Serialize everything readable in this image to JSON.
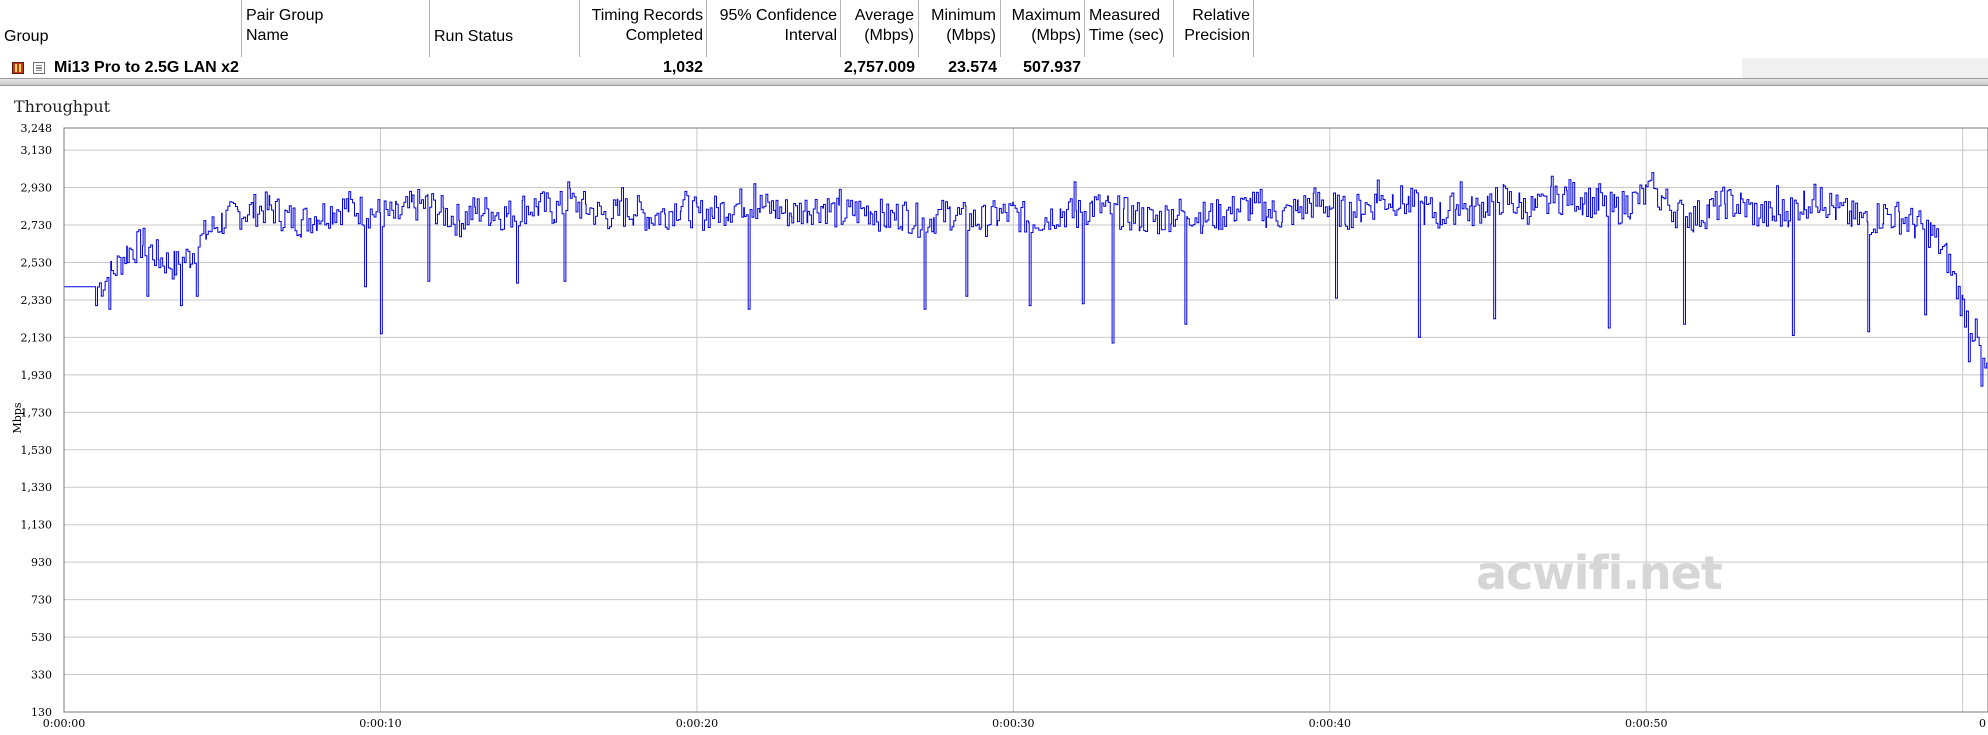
{
  "grid": {
    "columns": [
      {
        "key": "group",
        "label": "Group"
      },
      {
        "key": "pair_group_name",
        "label": "Pair Group Name"
      },
      {
        "key": "run_status",
        "label": "Run Status"
      },
      {
        "key": "timing_records",
        "label": "Timing Records Completed"
      },
      {
        "key": "confidence",
        "label": "95% Confidence Interval"
      },
      {
        "key": "average",
        "label": "Average (Mbps)"
      },
      {
        "key": "minimum",
        "label": "Minimum (Mbps)"
      },
      {
        "key": "maximum",
        "label": "Maximum (Mbps)"
      },
      {
        "key": "measured_time",
        "label": "Measured Time (sec)"
      },
      {
        "key": "relative_precision",
        "label": "Relative Precision"
      }
    ],
    "row": {
      "group": "Mi13 Pro to 2.5G LAN x2",
      "timing_records": "1,032",
      "average": "2,757.009",
      "minimum": "23.574",
      "maximum": "507.937"
    }
  },
  "watermark": "acwifi.net",
  "chart_data": {
    "type": "line",
    "title": "Throughput",
    "ylabel": "Mbps",
    "ylim": [
      130,
      3248
    ],
    "yticks": [
      "3,248",
      "3,130",
      "2,930",
      "2,730",
      "2,530",
      "2,330",
      "2,130",
      "1,930",
      "1,730",
      "1,530",
      "1,330",
      "1,130",
      "930",
      "730",
      "530",
      "330",
      "130"
    ],
    "ytick_values": [
      3248,
      3130,
      2930,
      2730,
      2530,
      2330,
      2130,
      1930,
      1730,
      1530,
      1330,
      1130,
      930,
      730,
      530,
      330,
      130
    ],
    "xlim": [
      0,
      60.8
    ],
    "xticks": [
      "0:00:00",
      "0:00:10",
      "0:00:20",
      "0:00:30",
      "0:00:40",
      "0:00:50",
      "0"
    ],
    "xtick_values": [
      0,
      10,
      20,
      30,
      40,
      50,
      60
    ],
    "grid": true,
    "series": [
      {
        "color": "#0000e0",
        "x": [
          0,
          1,
          1.5,
          2,
          2.5,
          3,
          3.5,
          4,
          4.5,
          5,
          5.5,
          6,
          6.5,
          7,
          7.5,
          8,
          8.5,
          9,
          9.5,
          10,
          10.5,
          11,
          11.5,
          12,
          12.5,
          13,
          13.5,
          14,
          14.5,
          15,
          15.5,
          16,
          16.5,
          17,
          17.5,
          18,
          18.5,
          19,
          19.5,
          20,
          20.5,
          21,
          21.5,
          22,
          22.5,
          23,
          23.5,
          24,
          24.5,
          25,
          25.5,
          26,
          26.5,
          27,
          27.5,
          28,
          28.5,
          29,
          29.5,
          30,
          30.5,
          31,
          31.5,
          32,
          32.5,
          33,
          33.5,
          34,
          34.5,
          35,
          35.5,
          36,
          36.5,
          37,
          37.5,
          38,
          38.5,
          39,
          39.5,
          40,
          40.5,
          41,
          41.5,
          42,
          42.5,
          43,
          43.5,
          44,
          44.5,
          45,
          45.5,
          46,
          46.5,
          47,
          47.5,
          48,
          48.5,
          49,
          49.5,
          50,
          50.5,
          51,
          51.5,
          52,
          52.5,
          53,
          53.5,
          54,
          54.5,
          55,
          55.5,
          56,
          56.5,
          57,
          57.5,
          58,
          58.5,
          59,
          59.5,
          60,
          60.4,
          60.8
        ],
        "values": [
          2400,
          2400,
          2480,
          2600,
          2640,
          2560,
          2520,
          2580,
          2700,
          2760,
          2800,
          2820,
          2830,
          2780,
          2760,
          2790,
          2820,
          2840,
          2810,
          2800,
          2780,
          2840,
          2850,
          2800,
          2760,
          2820,
          2810,
          2790,
          2830,
          2840,
          2820,
          2860,
          2830,
          2790,
          2800,
          2820,
          2780,
          2800,
          2850,
          2790,
          2810,
          2830,
          2860,
          2840,
          2820,
          2800,
          2830,
          2840,
          2790,
          2810,
          2820,
          2770,
          2800,
          2760,
          2780,
          2800,
          2770,
          2760,
          2790,
          2800,
          2760,
          2780,
          2810,
          2790,
          2840,
          2820,
          2800,
          2780,
          2760,
          2800,
          2810,
          2780,
          2790,
          2820,
          2840,
          2810,
          2790,
          2820,
          2860,
          2840,
          2800,
          2830,
          2860,
          2880,
          2850,
          2820,
          2790,
          2840,
          2810,
          2860,
          2880,
          2840,
          2820,
          2860,
          2900,
          2880,
          2840,
          2820,
          2860,
          2900,
          2880,
          2800,
          2780,
          2820,
          2860,
          2840,
          2800,
          2780,
          2820,
          2860,
          2880,
          2820,
          2780,
          2760,
          2800,
          2780,
          2740,
          2700,
          2560,
          2300,
          2150,
          1900
        ],
        "spikes_low": [
          [
            1,
            2300
          ],
          [
            1.4,
            2280
          ],
          [
            2.6,
            2350
          ],
          [
            3.7,
            2300
          ],
          [
            4.2,
            2350
          ],
          [
            9.5,
            2400
          ],
          [
            10,
            2150
          ],
          [
            11.5,
            2430
          ],
          [
            14.3,
            2420
          ],
          [
            15.8,
            2430
          ],
          [
            21.6,
            2280
          ],
          [
            27.2,
            2280
          ],
          [
            28.5,
            2350
          ],
          [
            30.5,
            2300
          ],
          [
            32.2,
            2310
          ],
          [
            33.1,
            2100
          ],
          [
            35.4,
            2200
          ],
          [
            40.2,
            2340
          ],
          [
            42.8,
            2130
          ],
          [
            45.2,
            2230
          ],
          [
            48.8,
            2180
          ],
          [
            51.2,
            2200
          ],
          [
            54.6,
            2140
          ],
          [
            57,
            2160
          ],
          [
            58.8,
            2250
          ],
          [
            60.2,
            2000
          ],
          [
            60.6,
            1870
          ]
        ],
        "spikes_high": [
          [
            15.9,
            2960
          ],
          [
            21.8,
            2950
          ],
          [
            31.9,
            2960
          ],
          [
            41.5,
            2970
          ],
          [
            44.1,
            2960
          ],
          [
            47,
            2990
          ],
          [
            48.5,
            2950
          ],
          [
            50.2,
            3010
          ],
          [
            54.1,
            2940
          ],
          [
            55.5,
            2930
          ],
          [
            37.8,
            2920
          ],
          [
            17.6,
            2930
          ],
          [
            24.5,
            2920
          ]
        ]
      }
    ]
  }
}
